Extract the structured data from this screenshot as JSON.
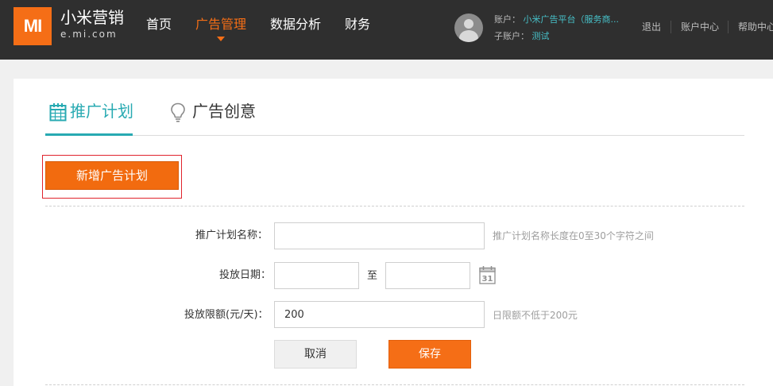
{
  "header": {
    "logo_text": "MI",
    "brand_name": "小米营销",
    "brand_domain": "e.mi.com",
    "nav": [
      {
        "label": "首页",
        "active": false
      },
      {
        "label": "广告管理",
        "active": true
      },
      {
        "label": "数据分析",
        "active": false
      },
      {
        "label": "财务",
        "active": false
      }
    ],
    "account": {
      "account_label": "账户：",
      "account_value": "小米广告平台（服务商...",
      "subaccount_label": "子账户：",
      "subaccount_value": "测试"
    },
    "links": {
      "logout": "退出",
      "account_center": "账户中心",
      "help_center": "帮助中心"
    }
  },
  "tabs": [
    {
      "label": "推广计划",
      "icon": "calendar-icon",
      "active": true
    },
    {
      "label": "广告创意",
      "icon": "lightbulb-icon",
      "active": false
    }
  ],
  "actions": {
    "new_plan": "新增广告计划"
  },
  "form": {
    "plan_name": {
      "label": "推广计划名称：",
      "value": "",
      "hint": "推广计划名称长度在0至30个字符之间"
    },
    "date": {
      "label": "投放日期：",
      "start_value": "",
      "separator": "至",
      "end_value": "",
      "calendar_day": "31"
    },
    "budget": {
      "label": "投放限额(元/天)：",
      "value": "200",
      "hint": "日限额不低于200元"
    },
    "cancel_label": "取消",
    "save_label": "保存"
  },
  "colors": {
    "accent_orange": "#f56e16",
    "accent_teal": "#28aab2",
    "header_bg": "#2f2f2f",
    "highlight_border": "#e0242d"
  }
}
